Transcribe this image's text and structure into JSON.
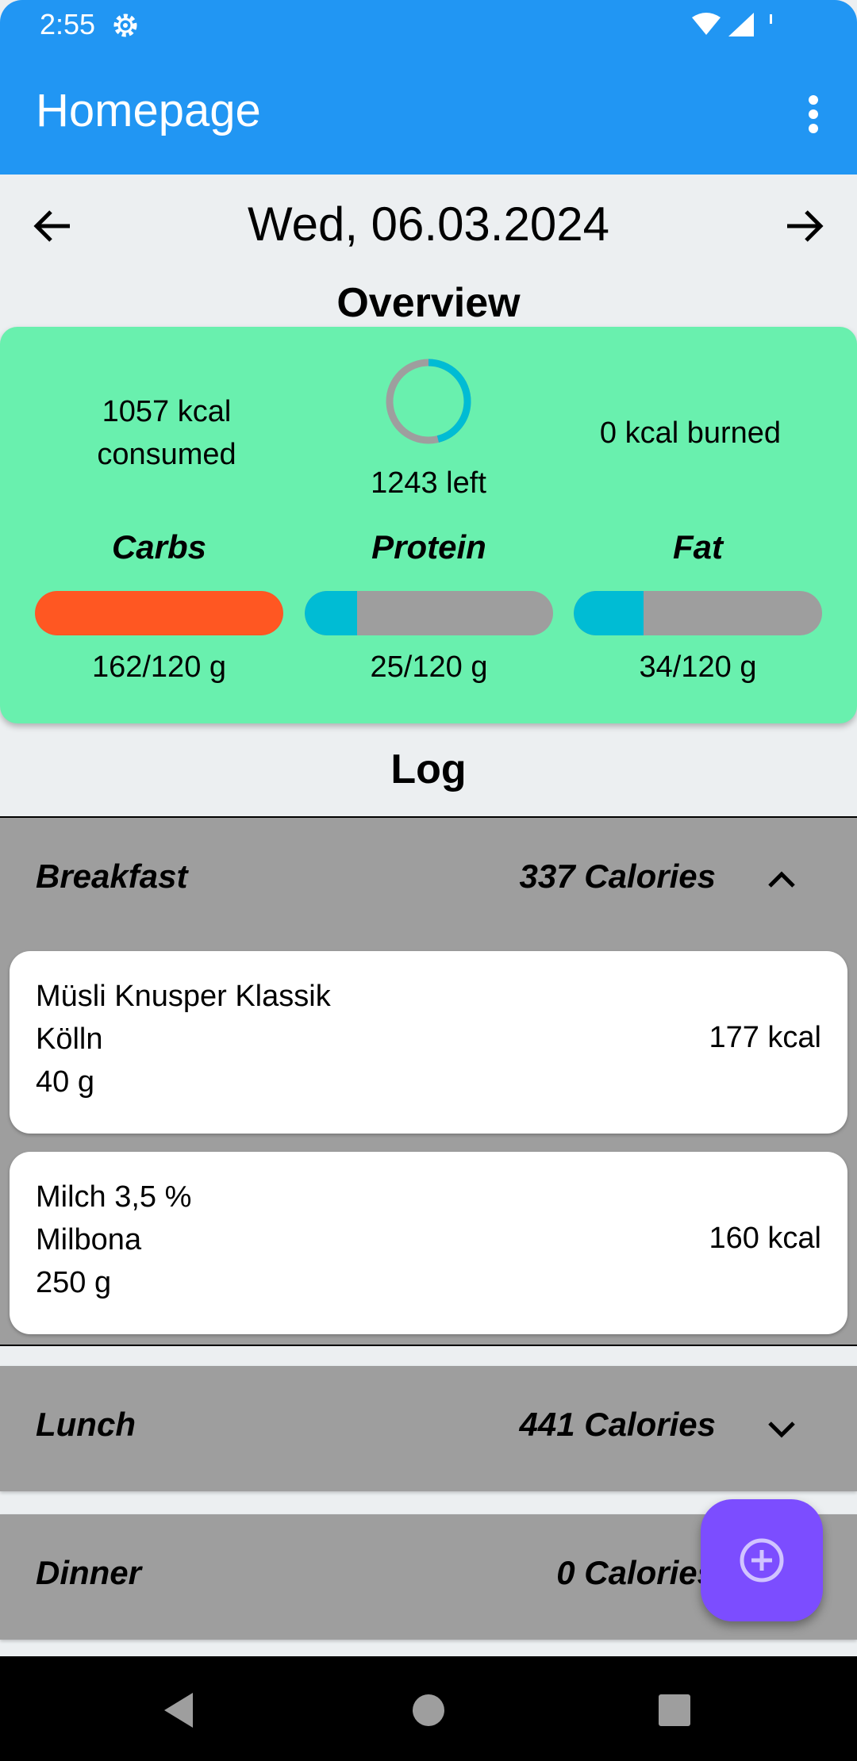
{
  "status_bar": {
    "time": "2:55",
    "icons": [
      "settings-icon",
      "wifi-icon",
      "signal-icon",
      "battery-icon"
    ]
  },
  "app_bar": {
    "title": "Homepage",
    "menu_icon": "more-vert-icon"
  },
  "date_nav": {
    "date": "Wed, 06.03.2024",
    "prev_icon": "arrow-left-icon",
    "next_icon": "arrow-right-icon"
  },
  "overview": {
    "title": "Overview",
    "consumed_line1": "1057 kcal",
    "consumed_line2": "consumed",
    "left": "1243 left",
    "left_progress": 0.46,
    "burned": "0 kcal burned",
    "macros": [
      {
        "name": "Carbs",
        "value": "162/120 g",
        "fraction": 1.0,
        "color": "#ff5722"
      },
      {
        "name": "Protein",
        "value": "25/120 g",
        "fraction": 0.21,
        "color": "#00bcd4"
      },
      {
        "name": "Fat",
        "value": "34/120 g",
        "fraction": 0.28,
        "color": "#00bcd4"
      }
    ]
  },
  "log": {
    "title": "Log",
    "meals": [
      {
        "name": "Breakfast",
        "calories": "337 Calories",
        "expanded": true,
        "items": [
          {
            "name": "Müsli Knusper Klassik",
            "brand": "Kölln",
            "amount": "40 g",
            "kcal": "177 kcal"
          },
          {
            "name": "Milch 3,5 %",
            "brand": "Milbona",
            "amount": "250 g",
            "kcal": "160 kcal"
          }
        ]
      },
      {
        "name": "Lunch",
        "calories": "441 Calories",
        "expanded": false
      },
      {
        "name": "Dinner",
        "calories": "0 Calories",
        "expanded": false
      }
    ]
  },
  "fab": {
    "icon": "add-circle-icon"
  },
  "nav_bar": {
    "icons": [
      "back-icon",
      "home-icon",
      "recents-icon"
    ]
  },
  "colors": {
    "primary": "#2196f3",
    "overview_bg": "#69f0ae",
    "meal_header_bg": "#9e9e9e",
    "fab": "#7c4dff",
    "bar_track": "#9e9e9e"
  }
}
